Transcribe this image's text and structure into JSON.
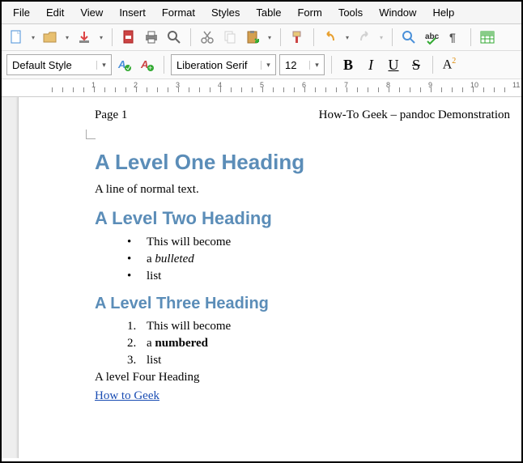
{
  "menu": [
    "File",
    "Edit",
    "View",
    "Insert",
    "Format",
    "Styles",
    "Table",
    "Form",
    "Tools",
    "Window",
    "Help"
  ],
  "toolbar2": {
    "style": "Default Style",
    "font": "Liberation Serif",
    "size": "12"
  },
  "ruler_labels": [
    "1",
    "2",
    "3",
    "4",
    "5",
    "6",
    "7",
    "8",
    "9",
    "10",
    "11"
  ],
  "header": {
    "page": "Page 1",
    "title": "How-To Geek – pandoc Demonstration"
  },
  "doc": {
    "h1": "A Level One Heading",
    "p1": "A line of normal text.",
    "h2": "A Level Two Heading",
    "ul": [
      {
        "pre": "This will become",
        "ital": "",
        "post": ""
      },
      {
        "pre": "a ",
        "ital": "bulleted",
        "post": ""
      },
      {
        "pre": "list",
        "ital": "",
        "post": ""
      }
    ],
    "h3": "A Level Three Heading",
    "ol": [
      {
        "pre": "This will become",
        "bold": "",
        "post": ""
      },
      {
        "pre": "a ",
        "bold": "numbered",
        "post": ""
      },
      {
        "pre": "list",
        "bold": "",
        "post": ""
      }
    ],
    "p4": "A level Four Heading",
    "link": "How to Geek"
  }
}
